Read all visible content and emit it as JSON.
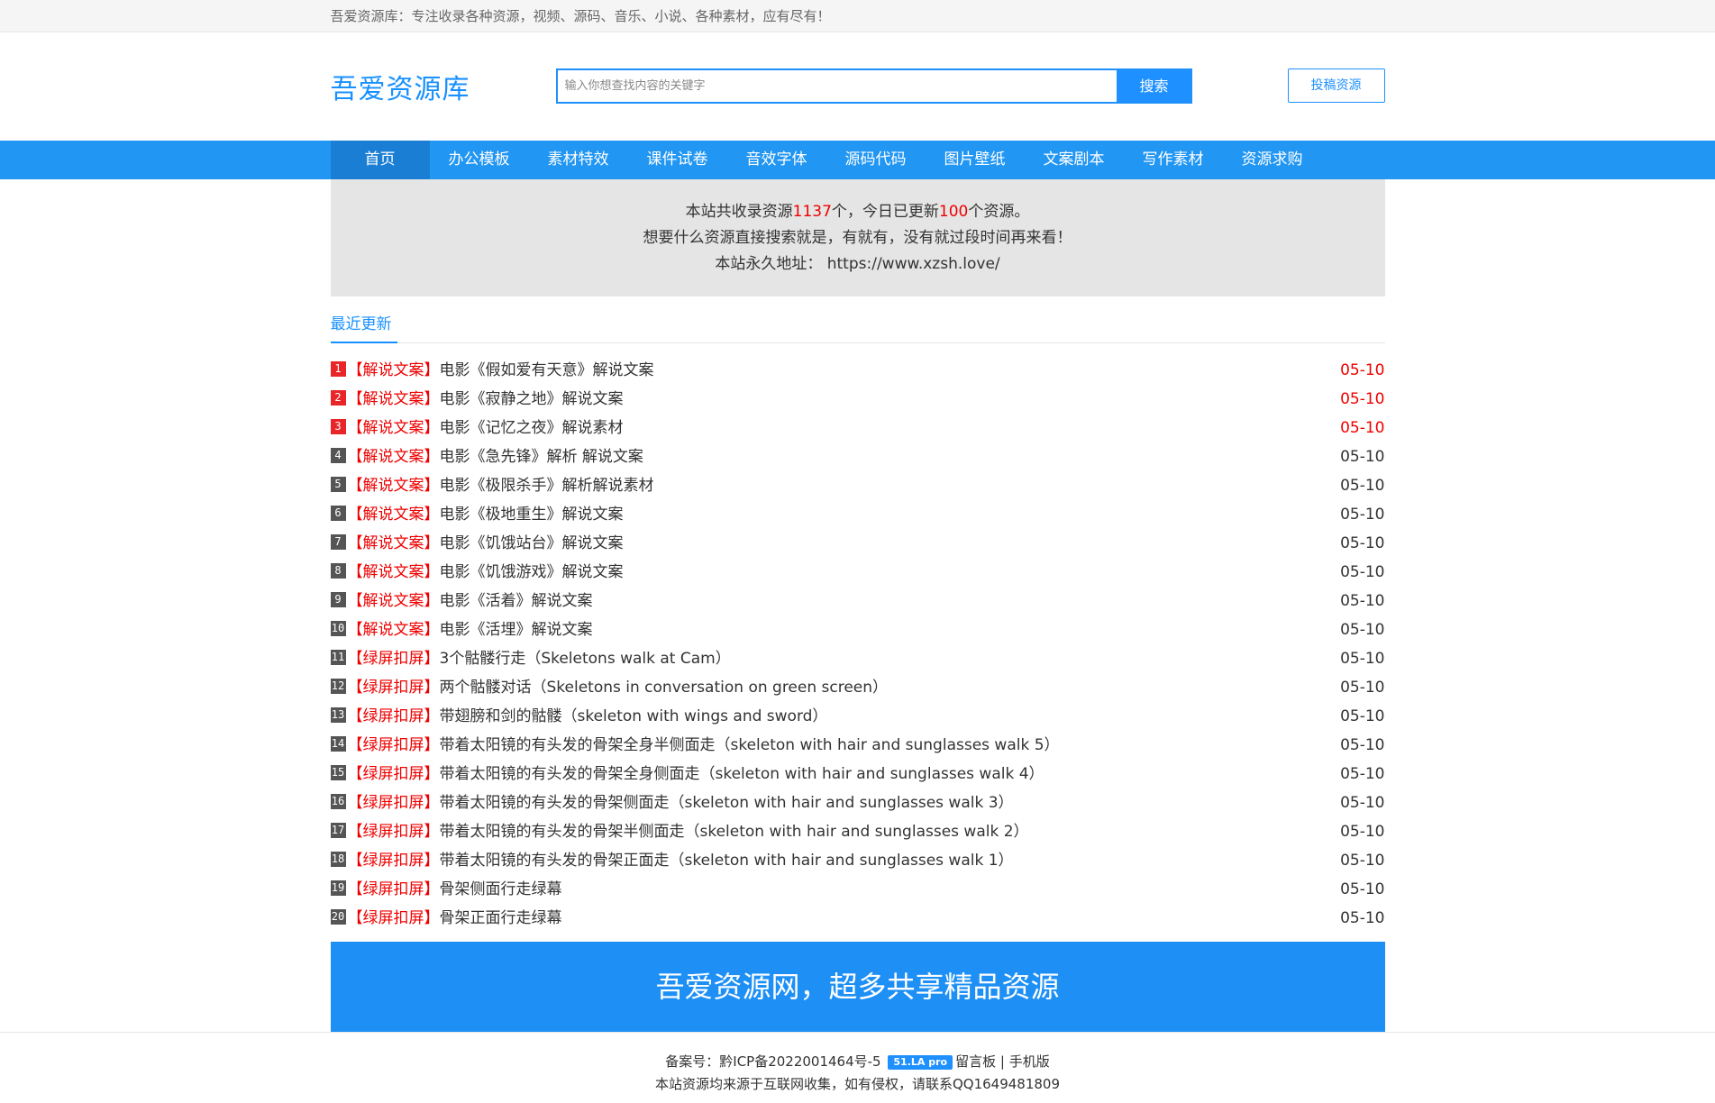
{
  "topbar": {
    "text": "吾爱资源库：专注收录各种资源，视频、源码、音乐、小说、各种素材，应有尽有！"
  },
  "header": {
    "logo": "吾爱资源库",
    "search_placeholder": "输入你想查找内容的关键字",
    "search_button": "搜索",
    "submit_button": "投稿资源"
  },
  "nav": {
    "items": [
      "首页",
      "办公模板",
      "素材特效",
      "课件试卷",
      "音效字体",
      "源码代码",
      "图片壁纸",
      "文案剧本",
      "写作素材",
      "资源求购"
    ]
  },
  "notice": {
    "line1_a": "本站共收录资源",
    "total": "1137",
    "line1_b": "个，今日已更新",
    "today": "100",
    "line1_c": "个资源。",
    "line2": "想要什么资源直接搜索就是，有就有，没有就过段时间再来看！",
    "line3": "本站永久地址： https://www.xzsh.love/"
  },
  "section": {
    "tab": "最近更新"
  },
  "list": [
    {
      "num": "1",
      "cat": "【解说文案】",
      "title": "电影《假如爱有天意》解说文案",
      "date": "05-10"
    },
    {
      "num": "2",
      "cat": "【解说文案】",
      "title": "电影《寂静之地》解说文案",
      "date": "05-10"
    },
    {
      "num": "3",
      "cat": "【解说文案】",
      "title": "电影《记忆之夜》解说素材",
      "date": "05-10"
    },
    {
      "num": "4",
      "cat": "【解说文案】",
      "title": "电影《急先锋》解析 解说文案",
      "date": "05-10"
    },
    {
      "num": "5",
      "cat": "【解说文案】",
      "title": "电影《极限杀手》解析解说素材",
      "date": "05-10"
    },
    {
      "num": "6",
      "cat": "【解说文案】",
      "title": "电影《极地重生》解说文案",
      "date": "05-10"
    },
    {
      "num": "7",
      "cat": "【解说文案】",
      "title": "电影《饥饿站台》解说文案",
      "date": "05-10"
    },
    {
      "num": "8",
      "cat": "【解说文案】",
      "title": "电影《饥饿游戏》解说文案",
      "date": "05-10"
    },
    {
      "num": "9",
      "cat": "【解说文案】",
      "title": "电影《活着》解说文案",
      "date": "05-10"
    },
    {
      "num": "10",
      "cat": "【解说文案】",
      "title": "电影《活埋》解说文案",
      "date": "05-10"
    },
    {
      "num": "11",
      "cat": "【绿屏扣屏】",
      "title": "3个骷髅行走（Skeletons walk at Cam）",
      "date": "05-10"
    },
    {
      "num": "12",
      "cat": "【绿屏扣屏】",
      "title": "两个骷髅对话（Skeletons in conversation on green screen）",
      "date": "05-10"
    },
    {
      "num": "13",
      "cat": "【绿屏扣屏】",
      "title": "带翅膀和剑的骷髅（skeleton with wings and sword）",
      "date": "05-10"
    },
    {
      "num": "14",
      "cat": "【绿屏扣屏】",
      "title": "带着太阳镜的有头发的骨架全身半侧面走（skeleton with hair and sunglasses walk 5）",
      "date": "05-10"
    },
    {
      "num": "15",
      "cat": "【绿屏扣屏】",
      "title": "带着太阳镜的有头发的骨架全身侧面走（skeleton with hair and sunglasses walk 4）",
      "date": "05-10"
    },
    {
      "num": "16",
      "cat": "【绿屏扣屏】",
      "title": "带着太阳镜的有头发的骨架侧面走（skeleton with hair and sunglasses walk 3）",
      "date": "05-10"
    },
    {
      "num": "17",
      "cat": "【绿屏扣屏】",
      "title": "带着太阳镜的有头发的骨架半侧面走（skeleton with hair and sunglasses walk 2）",
      "date": "05-10"
    },
    {
      "num": "18",
      "cat": "【绿屏扣屏】",
      "title": "带着太阳镜的有头发的骨架正面走（skeleton with hair and sunglasses walk 1）",
      "date": "05-10"
    },
    {
      "num": "19",
      "cat": "【绿屏扣屏】",
      "title": "骨架侧面行走绿幕",
      "date": "05-10"
    },
    {
      "num": "20",
      "cat": "【绿屏扣屏】",
      "title": "骨架正面行走绿幕",
      "date": "05-10"
    }
  ],
  "banner": {
    "text": "吾爱资源网，超多共享精品资源"
  },
  "footer": {
    "icp_label": "备案号：",
    "icp": "黔ICP备2022001464号-5",
    "badge": "51.LA pro",
    "guestbook": "留言板",
    "sep": "|",
    "mobile": "手机版",
    "disclaimer": "本站资源均来源于互联网收集，如有侵权，请联系QQ1649481809"
  },
  "colors": {
    "accent": "#1e90ff",
    "nav": "#2196f3",
    "hot": "#e00000"
  }
}
